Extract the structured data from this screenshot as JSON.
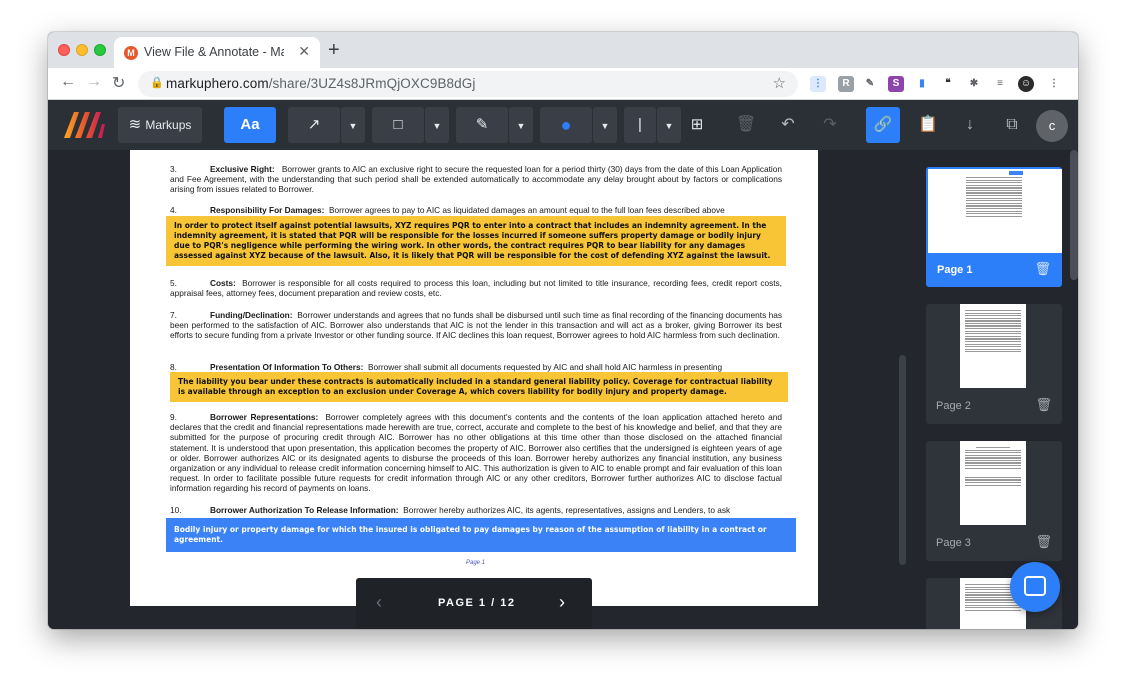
{
  "browser": {
    "tab_title": "View File & Annotate - Markup",
    "tab_favicon": "M",
    "url_host": "markuphero.com",
    "url_path": "/share/3UZ4s8JRmQjOXC9B8dGj"
  },
  "toolbar": {
    "markups_label": "Markups",
    "text_tool_label": "Aa",
    "avatar_initial": "c",
    "accent_color": "#2d7ff9"
  },
  "document": {
    "sections": [
      {
        "num": "3.",
        "heading": "Exclusive Right:",
        "text": "Borrower grants to AIC an exclusive right to secure the requested loan for a period thirty (30) days from the date of this Loan Application and Fee Agreement, with the understanding that such period shall be extended automatically to accommodate any delay brought about by factors or complications arising from issues related to Borrower."
      },
      {
        "num": "4.",
        "heading": "Responsibility For Damages:",
        "text": "Borrower agrees to pay to AIC as liquidated damages an amount equal to the full loan fees described above"
      },
      {
        "num": "5.",
        "heading": "Costs:",
        "text": "Borrower is responsible for all costs required to process this loan, including but not limited to title insurance, recording fees, credit report costs, appraisal fees, attorney fees, document preparation and review costs, etc."
      },
      {
        "num": "7.",
        "heading": "Funding/Declination:",
        "text": "Borrower understands and agrees that no funds shall be disbursed until such time as final recording of the financing documents has been performed to the satisfaction of AIC. Borrower also understands that AIC is not the lender in this transaction and will act as a broker, giving Borrower its best efforts to secure funding from a private Investor or other funding source. If AIC declines this loan request, Borrower agrees to hold AIC harmless from such declination."
      },
      {
        "num": "8.",
        "heading": "Presentation Of Information To Others:",
        "text": "Borrower shall submit all documents requested by AIC and shall hold AIC harmless in presenting"
      },
      {
        "num": "9.",
        "heading": "Borrower Representations:",
        "text": "Borrower completely agrees with this document's contents and the contents of the loan application attached hereto and declares that the credit and financial representations made herewith are true, correct, accurate and complete to the best of his knowledge and belief, and that they are submitted for the purpose of procuring credit through AIC. Borrower has no other obligations at this time other than those disclosed on the attached financial statement. It is understood that upon presentation, this application becomes the property of AIC. Borrower also certifies that the undersigned is eighteen years of age or older. Borrower authorizes AIC or its designated agents to disburse the proceeds of this loan. Borrower hereby authorizes any financial institution, any business organization or any individual to release credit information concerning himself to AIC. This authorization is given to AIC to enable prompt and fair evaluation of this loan request. In order to facilitate possible future requests for credit information through AIC or any other creditors, Borrower further authorizes AIC to disclose factual information regarding his record of payments on loans."
      },
      {
        "num": "10.",
        "heading": "Borrower Authorization To Release Information:",
        "text": "Borrower hereby authorizes AIC, its agents, representatives, assigns and Lenders, to ask"
      }
    ],
    "page_label": "Page 1"
  },
  "annotations": {
    "note1": "In order to protect itself against potential lawsuits, XYZ requires PQR to enter into a contract that includes an indemnity agreement. In the indemnity agreement, it is stated that PQR will be responsible for the losses incurred if someone suffers property damage or bodily injury due to PQR's negligence while performing the wiring work. In other words, the contract requires PQR to bear liability for any damages assessed against XYZ because of the lawsuit. Also, it is likely that PQR will be responsible for the cost of defending XYZ against the lawsuit.",
    "note2": "The liability you bear under these contracts is automatically included in a standard general liability policy. Coverage for contractual liability is available through an exception to an exclusion under Coverage A, which covers liability for bodily injury and property damage.",
    "note3": "Bodily injury or property damage for which the insured is obligated to pay damages by reason of the assumption of liability in a contract or agreement.",
    "yellow_color": "#f7c536",
    "blue_color": "#3a82f6"
  },
  "pager": {
    "label": "PAGE 1 / 12"
  },
  "thumbnails": [
    {
      "label": "Page 1"
    },
    {
      "label": "Page 2"
    },
    {
      "label": "Page 3"
    }
  ]
}
